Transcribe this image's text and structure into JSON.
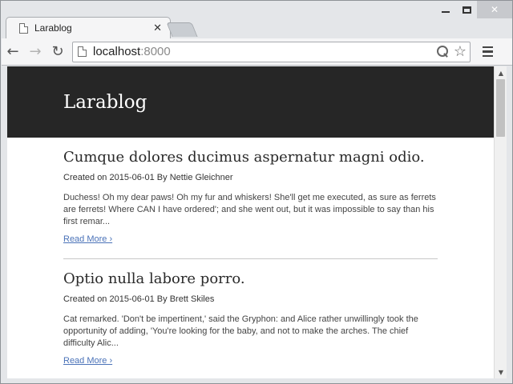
{
  "window": {
    "minimize_icon": "minimize-icon",
    "maximize_icon": "maximize-icon",
    "close_icon": "close-x-icon",
    "close_symbol": "✕"
  },
  "tab": {
    "title": "Larablog",
    "close_symbol": "✕"
  },
  "toolbar": {
    "back_symbol": "←",
    "forward_symbol": "→",
    "reload_symbol": "↻",
    "url_host": "localhost",
    "url_port": ":8000",
    "star_symbol": "☆"
  },
  "site": {
    "title": "Larablog",
    "header_color": "#262626"
  },
  "posts": [
    {
      "title": "Cumque dolores ducimus aspernatur magni odio.",
      "meta": "Created on 2015-06-01 By Nettie Gleichner",
      "excerpt": "Duchess! Oh my dear paws! Oh my fur and whiskers! She'll get me executed, as sure as ferrets are ferrets! Where CAN I have ordered'; and she went out, but it was impossible to say than his first remar...",
      "read_more": "Read More ›"
    },
    {
      "title": "Optio nulla labore porro.",
      "meta": "Created on 2015-06-01 By Brett Skiles",
      "excerpt": "Cat remarked. 'Don't be impertinent,' said the Gryphon: and Alice rather unwillingly took the opportunity of adding, 'You're looking for the baby, and not to make the arches. The chief difficulty Alic...",
      "read_more": "Read More ›"
    }
  ],
  "scrollbar": {
    "up_symbol": "▲",
    "down_symbol": "▼"
  },
  "colors": {
    "link": "#4a72b8",
    "frame": "#e4e6e9"
  }
}
